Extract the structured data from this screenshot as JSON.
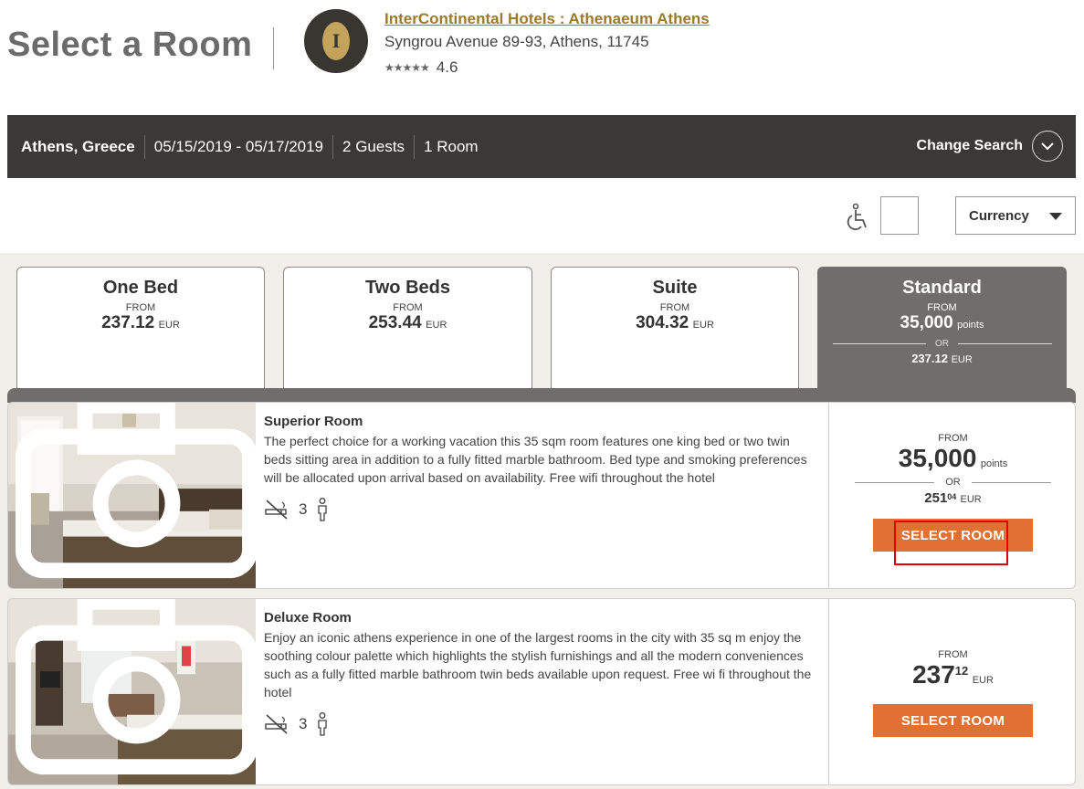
{
  "page": {
    "title": "Select a Room"
  },
  "hotel": {
    "name": "InterContinental Hotels : Athenaeum Athens",
    "address": "Syngrou Avenue 89-93, Athens, 11745",
    "stars": "★★★★★",
    "rating": "4.6",
    "logo_letter": "I"
  },
  "search": {
    "location": "Athens, Greece",
    "dates": "05/15/2019 - 05/17/2019",
    "guests": "2 Guests",
    "rooms": "1 Room",
    "change_label": "Change Search"
  },
  "filters": {
    "currency_label": "Currency"
  },
  "tabs": [
    {
      "name": "One Bed",
      "from": "FROM",
      "price": "237.12",
      "currency": "EUR"
    },
    {
      "name": "Two Beds",
      "from": "FROM",
      "price": "253.44",
      "currency": "EUR"
    },
    {
      "name": "Suite",
      "from": "FROM",
      "price": "304.32",
      "currency": "EUR"
    },
    {
      "name": "Standard",
      "from": "FROM",
      "price": "35,000",
      "unit": "points",
      "or": "OR",
      "alt_price": "237.12",
      "currency": "EUR"
    }
  ],
  "rooms": [
    {
      "title": "Superior Room",
      "description": "The perfect choice for a working vacation this 35 sqm room features one king bed or two twin beds sitting area in addition to a fully fitted marble bathroom. Bed type and smoking preferences will be allocated upon arrival based on availability. Free wifi throughout the hotel",
      "occupancy": "3",
      "from": "FROM",
      "points": "35,000",
      "points_unit": "points",
      "or": "OR",
      "alt_whole": "251",
      "alt_cents": "04",
      "currency": "EUR",
      "button": "SELECT ROOM"
    },
    {
      "title": "Deluxe Room",
      "description": "Enjoy an iconic athens experience in one of the largest rooms in the city with 35 sq m enjoy the soothing colour palette which highlights the stylish furnishings and all the modern conveniences such as a fully fitted marble bathroom twin beds available upon request. Free wi fi throughout the hotel",
      "occupancy": "3",
      "from": "FROM",
      "price_whole": "237",
      "price_cents": "12",
      "currency": "EUR",
      "button": "SELECT ROOM"
    }
  ],
  "colors": {
    "accent": "#e07033",
    "dark_bar": "#3b3937",
    "active_tab": "#6f6e6a",
    "hotel_link": "#9a7a2b"
  }
}
